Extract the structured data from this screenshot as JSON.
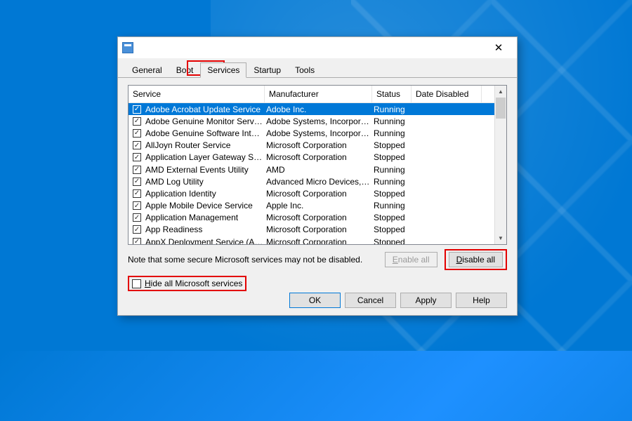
{
  "tabs": [
    "General",
    "Boot",
    "Services",
    "Startup",
    "Tools"
  ],
  "active_tab_index": 2,
  "columns": {
    "service": "Service",
    "manufacturer": "Manufacturer",
    "status": "Status",
    "date_disabled": "Date Disabled"
  },
  "rows": [
    {
      "checked": true,
      "selected": true,
      "service": "Adobe Acrobat Update Service",
      "manufacturer": "Adobe Inc.",
      "status": "Running",
      "date": ""
    },
    {
      "checked": true,
      "selected": false,
      "service": "Adobe Genuine Monitor Service",
      "manufacturer": "Adobe Systems, Incorpora...",
      "status": "Running",
      "date": ""
    },
    {
      "checked": true,
      "selected": false,
      "service": "Adobe Genuine Software Integri...",
      "manufacturer": "Adobe Systems, Incorpora...",
      "status": "Running",
      "date": ""
    },
    {
      "checked": true,
      "selected": false,
      "service": "AllJoyn Router Service",
      "manufacturer": "Microsoft Corporation",
      "status": "Stopped",
      "date": ""
    },
    {
      "checked": true,
      "selected": false,
      "service": "Application Layer Gateway Service",
      "manufacturer": "Microsoft Corporation",
      "status": "Stopped",
      "date": ""
    },
    {
      "checked": true,
      "selected": false,
      "service": "AMD External Events Utility",
      "manufacturer": "AMD",
      "status": "Running",
      "date": ""
    },
    {
      "checked": true,
      "selected": false,
      "service": "AMD Log Utility",
      "manufacturer": "Advanced Micro Devices, I...",
      "status": "Running",
      "date": ""
    },
    {
      "checked": true,
      "selected": false,
      "service": "Application Identity",
      "manufacturer": "Microsoft Corporation",
      "status": "Stopped",
      "date": ""
    },
    {
      "checked": true,
      "selected": false,
      "service": "Apple Mobile Device Service",
      "manufacturer": "Apple Inc.",
      "status": "Running",
      "date": ""
    },
    {
      "checked": true,
      "selected": false,
      "service": "Application Management",
      "manufacturer": "Microsoft Corporation",
      "status": "Stopped",
      "date": ""
    },
    {
      "checked": true,
      "selected": false,
      "service": "App Readiness",
      "manufacturer": "Microsoft Corporation",
      "status": "Stopped",
      "date": ""
    },
    {
      "checked": true,
      "selected": false,
      "service": "AppX Deployment Service (AppX...",
      "manufacturer": "Microsoft Corporation",
      "status": "Stopped",
      "date": ""
    }
  ],
  "note": "Note that some secure Microsoft services may not be disabled.",
  "buttons": {
    "enable_all_pre": "E",
    "enable_all_post": "nable all",
    "disable_all_pre": "D",
    "disable_all_post": "isable all"
  },
  "hide_checkbox": {
    "pre": "H",
    "post": "ide all Microsoft services"
  },
  "footer": {
    "ok": "OK",
    "cancel": "Cancel",
    "apply": "Apply",
    "help": "Help"
  }
}
